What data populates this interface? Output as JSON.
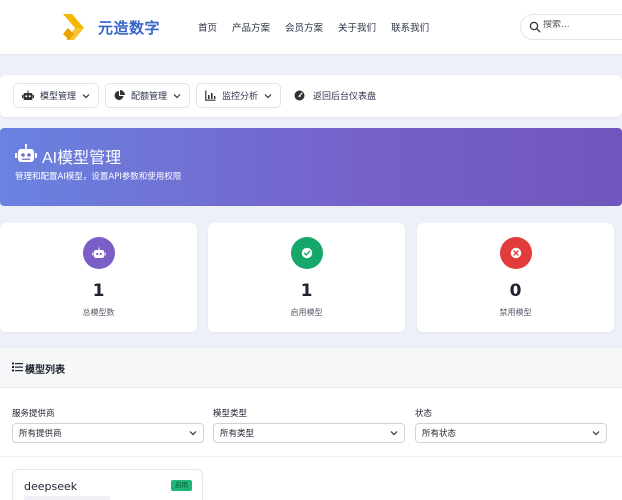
{
  "header": {
    "brand": "元造数字",
    "nav": [
      "首页",
      "产品方案",
      "会员方案",
      "关于我们",
      "联系我们"
    ],
    "search_placeholder": "搜索..."
  },
  "toolbar": {
    "model_mgmt": "模型管理",
    "quota_mgmt": "配额管理",
    "monitor": "监控分析",
    "back_dashboard": "返回后台仪表盘"
  },
  "hero": {
    "title": "AI模型管理",
    "subtitle": "管理和配置AI模型，设置API参数和使用权限"
  },
  "stats": [
    {
      "value": "1",
      "label": "总模型数",
      "color": "#7b5fc7"
    },
    {
      "value": "1",
      "label": "启用模型",
      "color": "#16a86b"
    },
    {
      "value": "0",
      "label": "禁用模型",
      "color": "#e23b3b"
    }
  ],
  "list": {
    "title": "模型列表",
    "filters": [
      {
        "label": "服务提供商",
        "value": "所有提供商"
      },
      {
        "label": "模型类型",
        "value": "所有类型"
      },
      {
        "label": "状态",
        "value": "所有状态"
      }
    ],
    "cards": [
      {
        "name": "deepseek",
        "badge": "启用"
      }
    ]
  },
  "colors": {
    "brand": "#3a63c9",
    "hero_start": "#6a82e0",
    "hero_end": "#6f56bd",
    "active_badge": "#1fb57a"
  }
}
